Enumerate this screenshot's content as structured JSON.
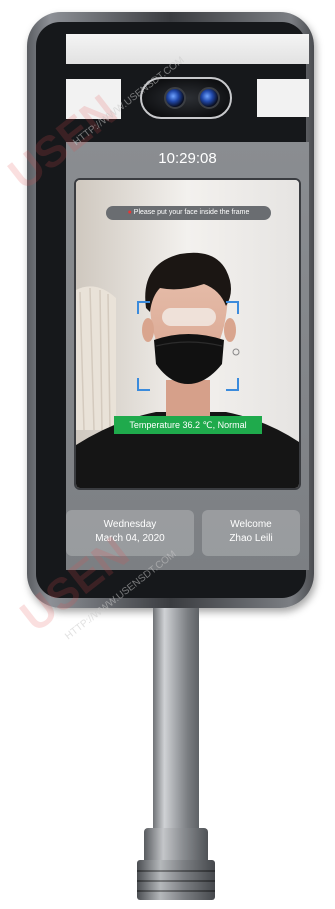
{
  "device": {
    "screen": {
      "time": "10:29:08",
      "prompt": "Please put your face inside the frame",
      "temperature_badge": "Temperature 36.2 ℃, Normal",
      "date_card": {
        "weekday": "Wednesday",
        "date": "March 04, 2020"
      },
      "welcome_card": {
        "greeting": "Welcome",
        "name": "Zhao Leili"
      }
    }
  },
  "watermark": {
    "logo": "USEN",
    "url": "HTTP://WWW.USENSDT.COM"
  },
  "colors": {
    "badge_green": "#1faa4c",
    "bezel": "#16181b",
    "screen_gray": "#8a8d91"
  }
}
